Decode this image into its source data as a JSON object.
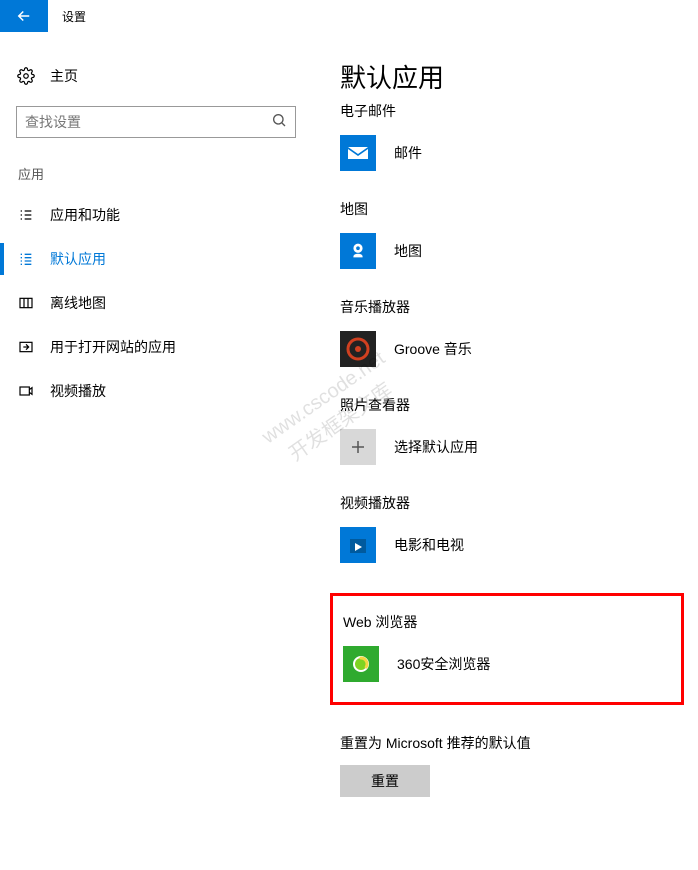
{
  "titlebar": {
    "title": "设置"
  },
  "sidebar": {
    "home": "主页",
    "search_placeholder": "查找设置",
    "category": "应用",
    "items": [
      {
        "label": "应用和功能"
      },
      {
        "label": "默认应用"
      },
      {
        "label": "离线地图"
      },
      {
        "label": "用于打开网站的应用"
      },
      {
        "label": "视频播放"
      }
    ]
  },
  "content": {
    "title": "默认应用",
    "sections": {
      "email": {
        "label": "电子邮件",
        "app": "邮件"
      },
      "maps": {
        "label": "地图",
        "app": "地图"
      },
      "music": {
        "label": "音乐播放器",
        "app": "Groove 音乐"
      },
      "photo": {
        "label": "照片查看器",
        "app": "选择默认应用"
      },
      "video": {
        "label": "视频播放器",
        "app": "电影和电视"
      },
      "web": {
        "label": "Web 浏览器",
        "app": "360安全浏览器"
      }
    },
    "reset": {
      "label": "重置为 Microsoft 推荐的默认值",
      "button": "重置"
    }
  },
  "watermark": {
    "line1": "www.cscode.net",
    "line2": "开发框架文库"
  }
}
